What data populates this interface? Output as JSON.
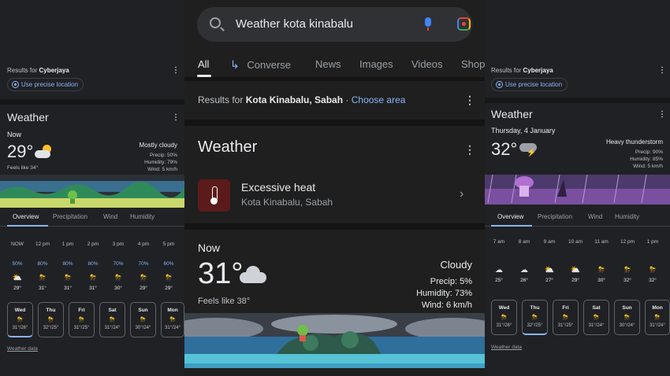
{
  "left": {
    "results_prefix": "Results for",
    "location": "Cyberjaya",
    "precise_location": "Use precise location",
    "card_title": "Weather",
    "now_label": "Now",
    "temperature": "29°",
    "condition": "Mostly cloudy",
    "precip": "Precip: 50%",
    "humidity": "Humidity: 79%",
    "wind": "Wind: 5 km/h",
    "feels_like": "Feels like 34°",
    "tabs": [
      "Overview",
      "Precipitation",
      "Wind",
      "Humidity"
    ],
    "hours": [
      {
        "time": "NOW",
        "precip": "50%",
        "icon": "partly-cloudy-icon",
        "temp": "29°"
      },
      {
        "time": "12 pm",
        "precip": "80%",
        "icon": "thunderstorm-icon",
        "temp": "31°"
      },
      {
        "time": "1 pm",
        "precip": "80%",
        "icon": "thunderstorm-icon",
        "temp": "31°"
      },
      {
        "time": "2 pm",
        "precip": "80%",
        "icon": "thunderstorm-icon",
        "temp": "31°"
      },
      {
        "time": "3 pm",
        "precip": "70%",
        "icon": "thunderstorm-icon",
        "temp": "30°"
      },
      {
        "time": "4 pm",
        "precip": "70%",
        "icon": "thunderstorm-icon",
        "temp": "29°"
      },
      {
        "time": "5 pm",
        "precip": "60%",
        "icon": "thunderstorm-icon",
        "temp": "29°"
      }
    ],
    "days": [
      {
        "name": "Wed",
        "temps": "31°/26°",
        "icon": "thunderstorm-icon"
      },
      {
        "name": "Thu",
        "temps": "32°/25°",
        "icon": "thunderstorm-icon"
      },
      {
        "name": "Fri",
        "temps": "31°/25°",
        "icon": "thunderstorm-icon"
      },
      {
        "name": "Sat",
        "temps": "31°/24°",
        "icon": "thunderstorm-icon"
      },
      {
        "name": "Sun",
        "temps": "30°/24°",
        "icon": "thunderstorm-icon"
      },
      {
        "name": "Mon",
        "temps": "31°/24°",
        "icon": "thunderstorm-icon"
      }
    ],
    "weather_data": "Weather data"
  },
  "middle": {
    "search_query": "Weather kota kinabalu",
    "tabs": [
      "All",
      "Converse",
      "News",
      "Images",
      "Videos",
      "Shop"
    ],
    "results_prefix": "Results for",
    "location": "Kota Kinabalu, Sabah",
    "choose_area": "Choose area",
    "card_title": "Weather",
    "alert_title": "Excessive heat",
    "alert_location": "Kota Kinabalu, Sabah",
    "now_label": "Now",
    "temperature": "31°",
    "condition": "Cloudy",
    "precip": "Precip: 5%",
    "humidity": "Humidity: 73%",
    "wind": "Wind: 6 km/h",
    "feels_like": "Feels like 38°"
  },
  "right": {
    "results_prefix": "Results for",
    "location": "Cyberjaya",
    "precise_location": "Use precise location",
    "card_title": "Weather",
    "date": "Thursday, 4 January",
    "temperature": "32°",
    "condition": "Heavy thunderstorm",
    "precip": "Precip: 90%",
    "humidity": "Humidity: 85%",
    "wind": "Wind: 5 km/h",
    "tabs": [
      "Overview",
      "Precipitation",
      "Wind",
      "Humidity"
    ],
    "hours": [
      {
        "time": "7 am",
        "icon": "cloudy-icon",
        "temp": "25°"
      },
      {
        "time": "8 am",
        "icon": "cloudy-icon",
        "temp": "26°"
      },
      {
        "time": "9 am",
        "icon": "partly-cloudy-icon",
        "temp": "27°"
      },
      {
        "time": "10 am",
        "icon": "partly-cloudy-icon",
        "temp": "29°"
      },
      {
        "time": "11 am",
        "icon": "thunderstorm-icon",
        "temp": "30°"
      },
      {
        "time": "12 pm",
        "icon": "thunderstorm-icon",
        "temp": "32°"
      },
      {
        "time": "1 pm",
        "icon": "thunderstorm-icon",
        "temp": "32°"
      }
    ],
    "days": [
      {
        "name": "Wed",
        "temps": "31°/26°",
        "icon": "thunderstorm-icon"
      },
      {
        "name": "Thu",
        "temps": "32°/25°",
        "icon": "thunderstorm-icon"
      },
      {
        "name": "Fri",
        "temps": "31°/25°",
        "icon": "thunderstorm-icon"
      },
      {
        "name": "Sat",
        "temps": "31°/24°",
        "icon": "thunderstorm-icon"
      },
      {
        "name": "Sun",
        "temps": "30°/24°",
        "icon": "thunderstorm-icon"
      },
      {
        "name": "Mon",
        "temps": "31°/24°",
        "icon": "thunderstorm-icon"
      }
    ],
    "weather_data": "Weather data"
  }
}
